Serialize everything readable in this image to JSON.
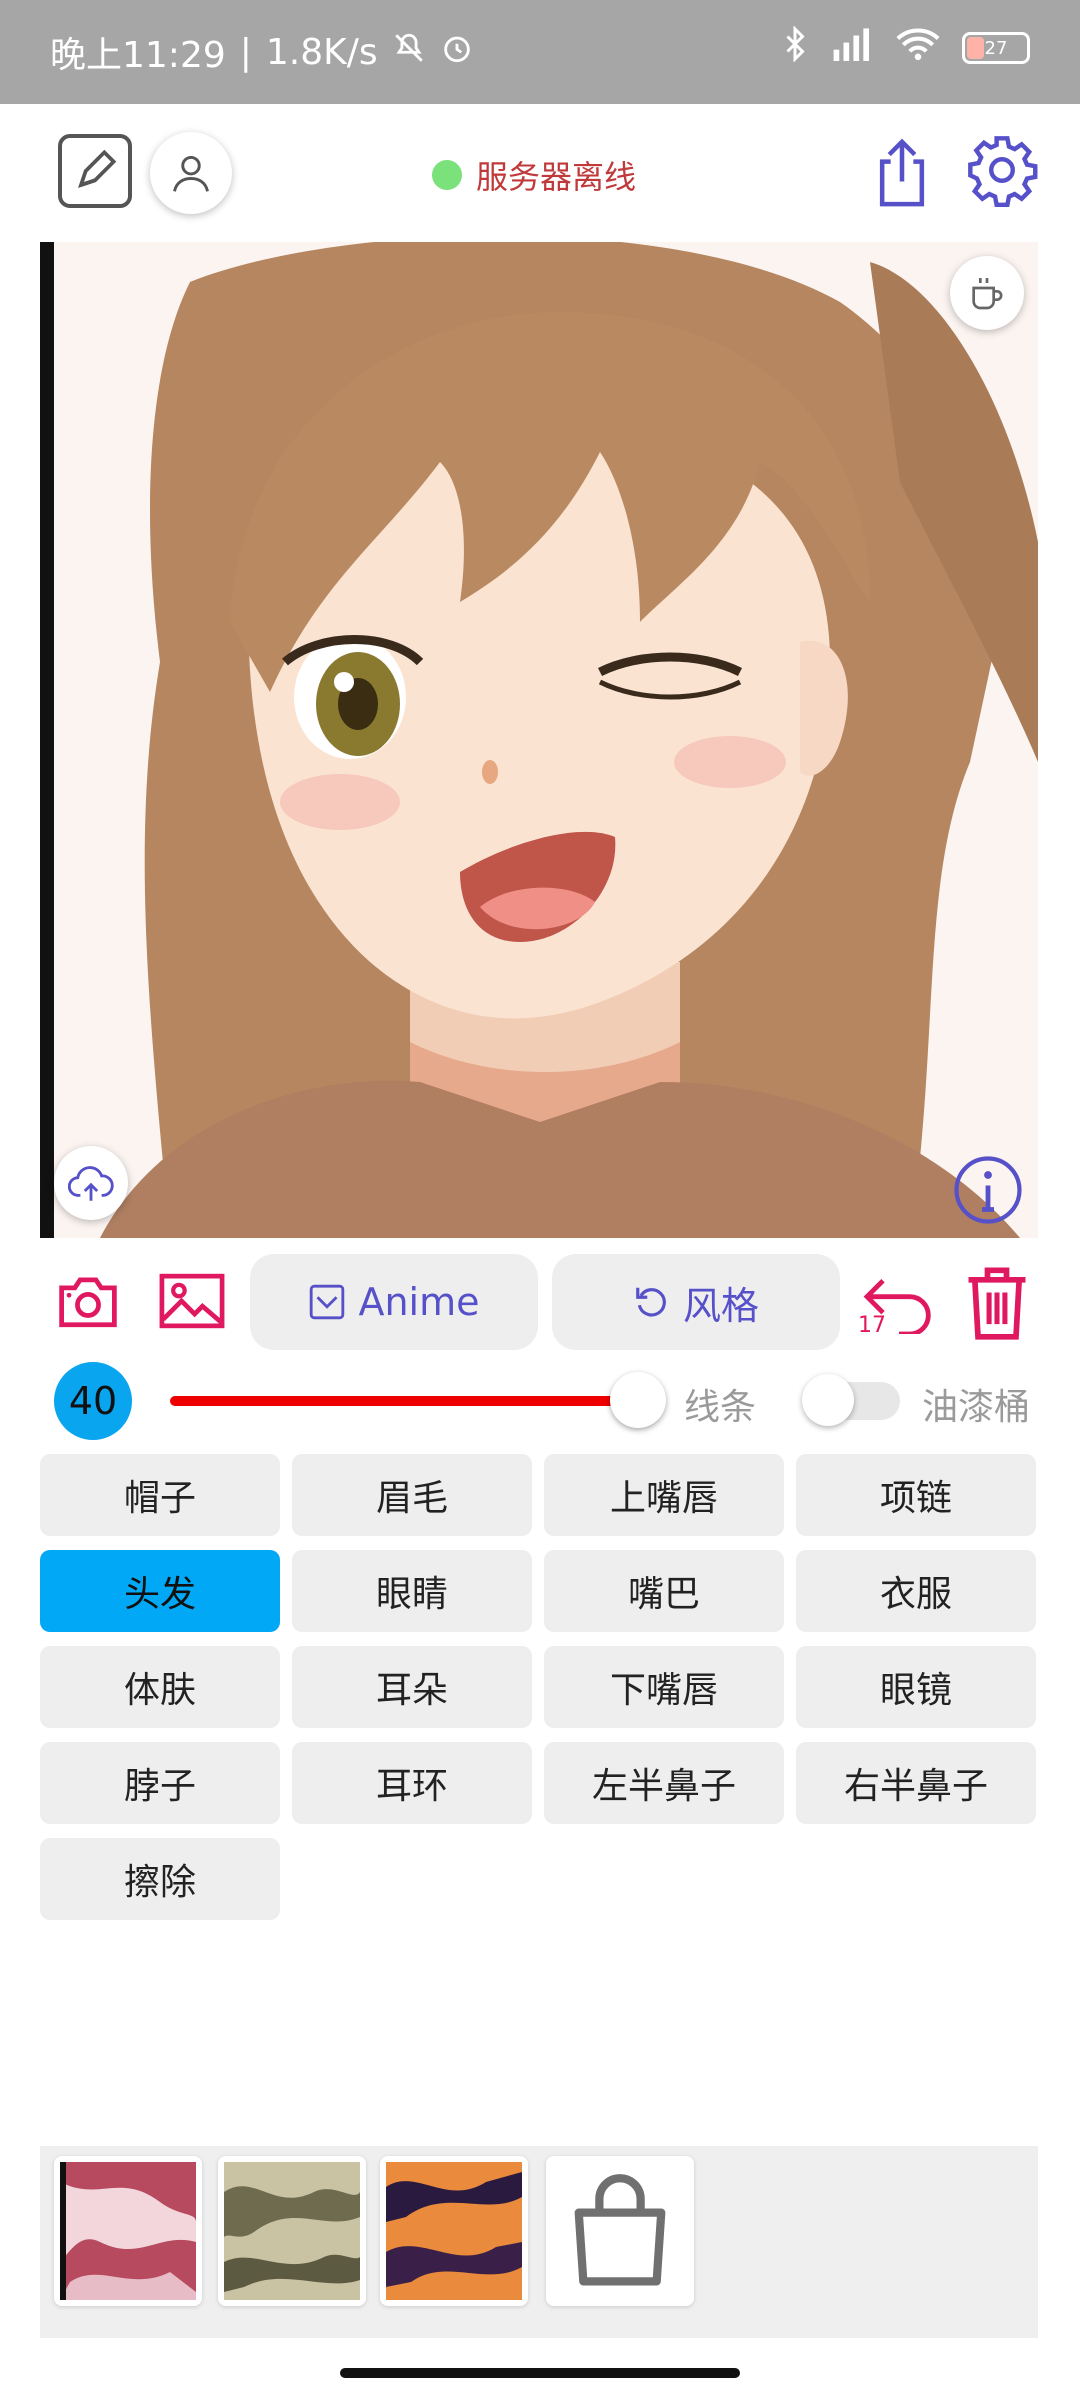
{
  "status_bar": {
    "time": "晚上11:29",
    "speed": "1.8K/s",
    "battery": "27"
  },
  "header": {
    "server_status": "服务器离线"
  },
  "actions": {
    "anime_label": "Anime",
    "style_label": "风格",
    "undo_count": "17"
  },
  "brush": {
    "size": "40",
    "lines_label": "线条",
    "bucket_label": "油漆桶",
    "bucket_enabled": false
  },
  "parts": [
    {
      "label": "帽子",
      "selected": false
    },
    {
      "label": "眉毛",
      "selected": false
    },
    {
      "label": "上嘴唇",
      "selected": false
    },
    {
      "label": "项链",
      "selected": false
    },
    {
      "label": "头发",
      "selected": true
    },
    {
      "label": "眼睛",
      "selected": false
    },
    {
      "label": "嘴巴",
      "selected": false
    },
    {
      "label": "衣服",
      "selected": false
    },
    {
      "label": "体肤",
      "selected": false
    },
    {
      "label": "耳朵",
      "selected": false
    },
    {
      "label": "下嘴唇",
      "selected": false
    },
    {
      "label": "眼镜",
      "selected": false
    },
    {
      "label": "脖子",
      "selected": false
    },
    {
      "label": "耳环",
      "selected": false
    },
    {
      "label": "左半鼻子",
      "selected": false
    },
    {
      "label": "右半鼻子",
      "selected": false
    },
    {
      "label": "擦除",
      "selected": false
    }
  ],
  "textures": [
    {
      "icon": "pink-texture-swatch"
    },
    {
      "icon": "olive-texture-swatch"
    },
    {
      "icon": "orange-texture-swatch"
    },
    {
      "icon": "shopping-bag-icon"
    }
  ],
  "colors": {
    "accent": "#5751c9",
    "active_part": "#00a8f5",
    "danger": "#e0185f",
    "slider": "#ee0000",
    "server_offline_text": "#c0393b",
    "server_dot": "#7be17a"
  }
}
